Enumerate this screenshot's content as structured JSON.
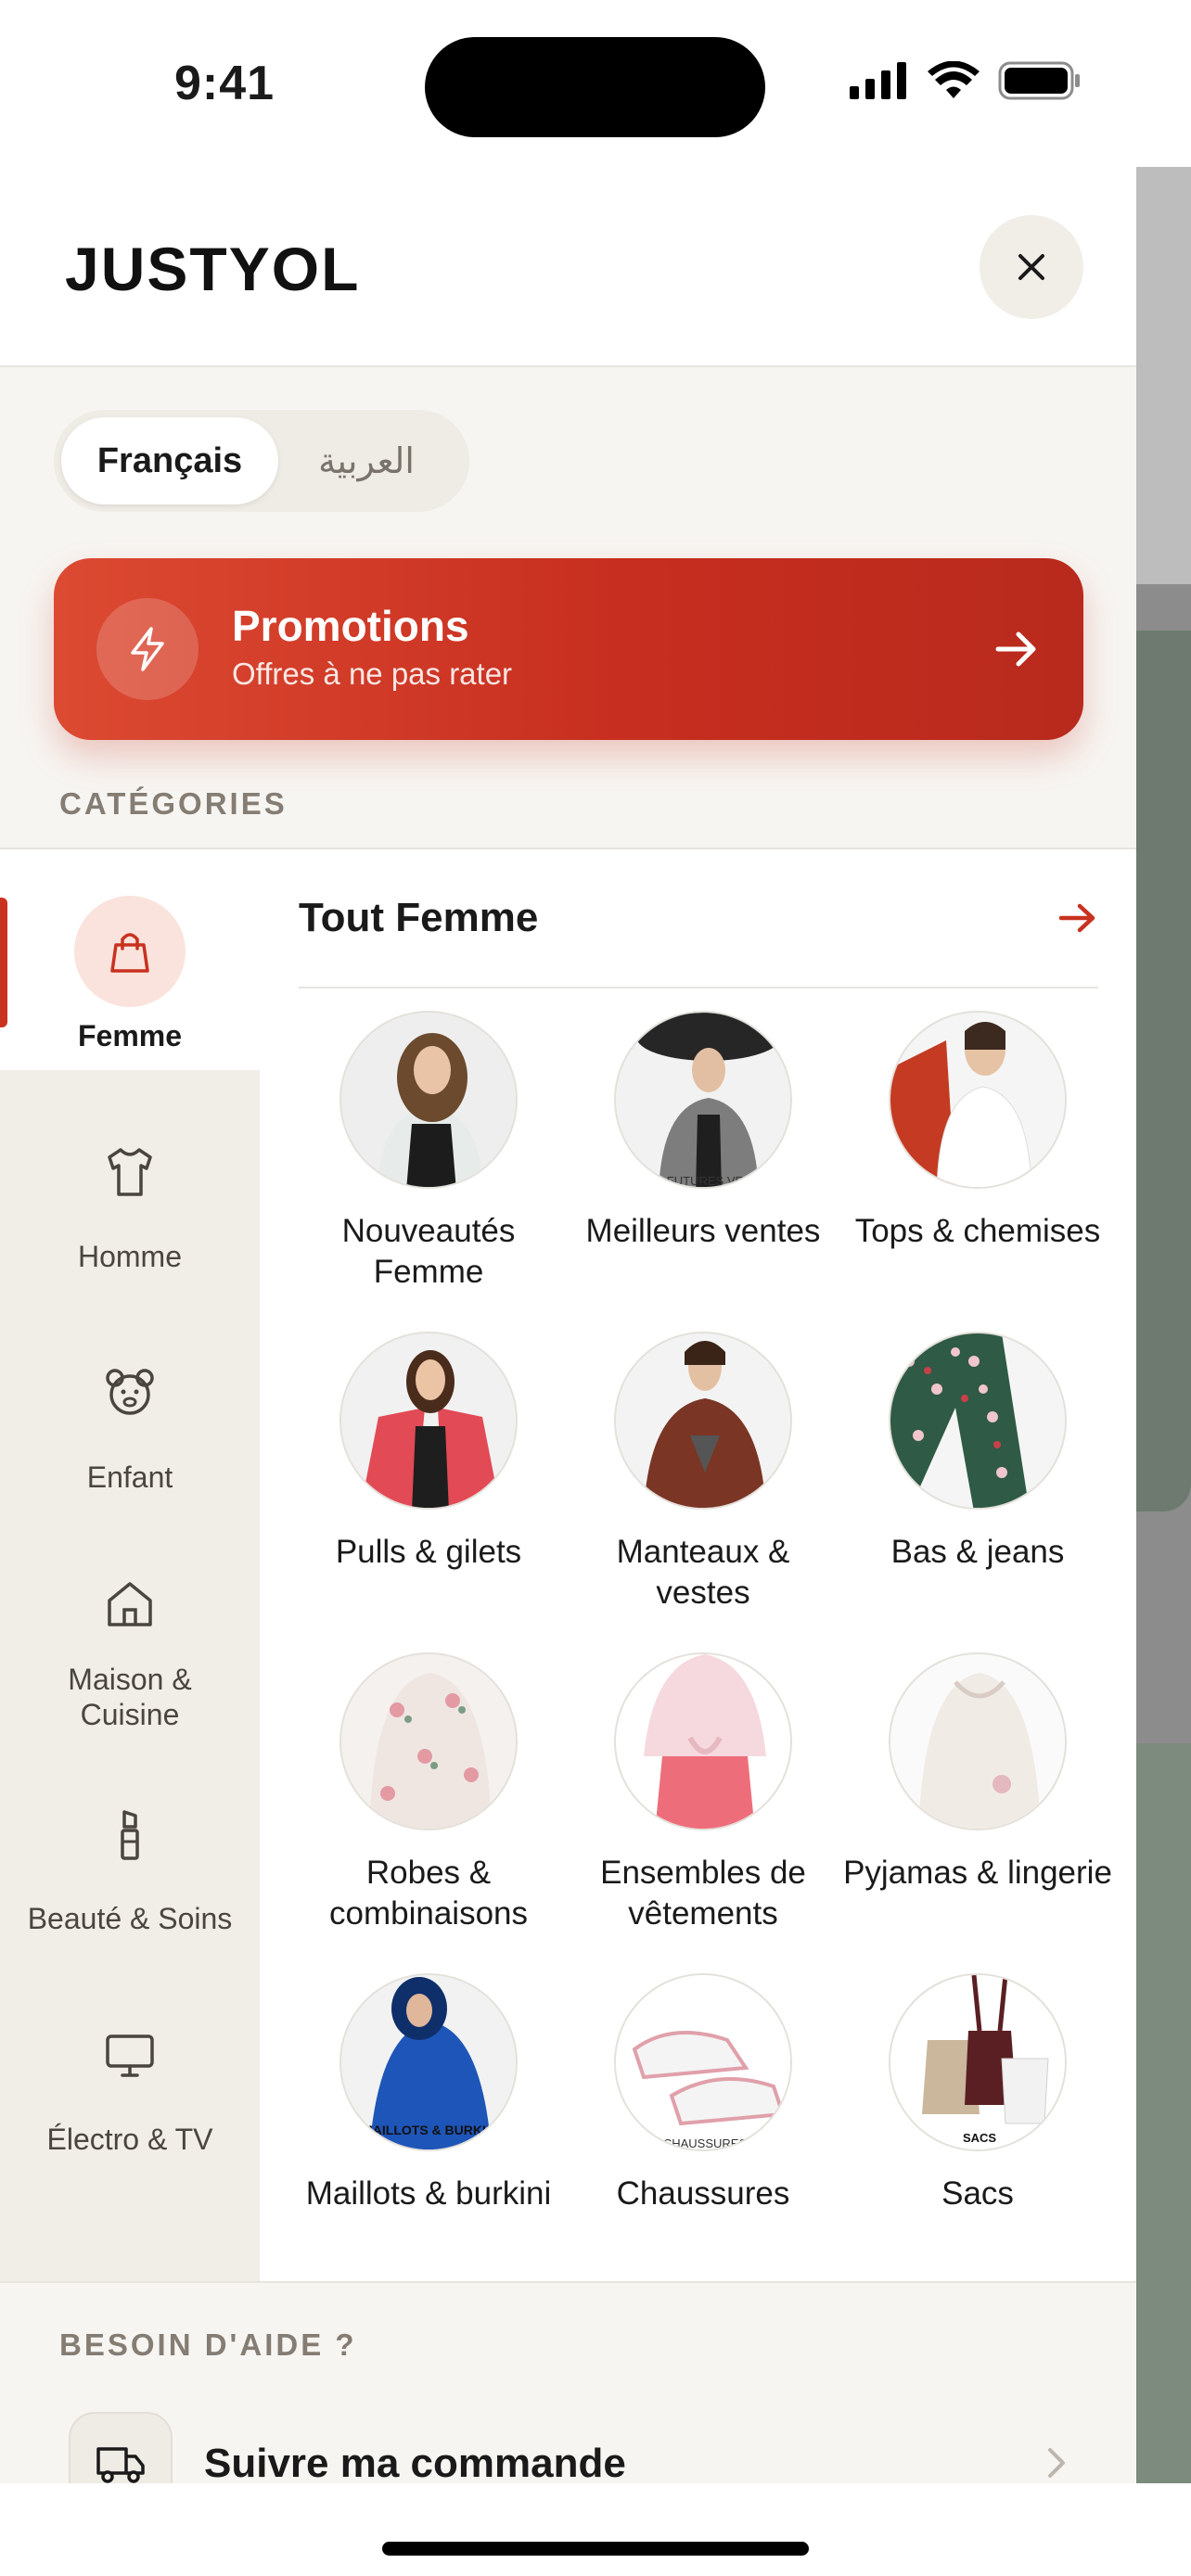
{
  "status_bar": {
    "time": "9:41"
  },
  "header": {
    "logo_text": "JUSTYOL"
  },
  "language": {
    "options": [
      {
        "label": "Français",
        "active": true
      },
      {
        "label": "العربية",
        "active": false
      }
    ]
  },
  "promo": {
    "title": "Promotions",
    "subtitle": "Offres à ne pas rater"
  },
  "categories": {
    "section_title": "CATÉGORIES",
    "items": [
      {
        "label": "Femme",
        "icon": "shopping-bag-icon",
        "active": true
      },
      {
        "label": "Homme",
        "icon": "tshirt-icon",
        "active": false
      },
      {
        "label": "Enfant",
        "icon": "teddy-bear-icon",
        "active": false
      },
      {
        "label": "Maison & Cuisine",
        "icon": "home-icon",
        "active": false
      },
      {
        "label": "Beauté & Soins",
        "icon": "lipstick-icon",
        "active": false
      },
      {
        "label": "Électro & TV",
        "icon": "monitor-icon",
        "active": false
      }
    ]
  },
  "subcategories": {
    "all_label": "Tout Femme",
    "items": [
      {
        "label": "Nouveautés Femme"
      },
      {
        "label": "Meilleurs ventes",
        "image_caption": "FUTURES VE"
      },
      {
        "label": "Tops & chemises"
      },
      {
        "label": "Pulls & gilets"
      },
      {
        "label": "Manteaux & vestes"
      },
      {
        "label": "Bas & jeans"
      },
      {
        "label": "Robes & combinaisons"
      },
      {
        "label": "Ensembles de vêtements"
      },
      {
        "label": "Pyjamas & lingerie"
      },
      {
        "label": "Maillots & burkini",
        "image_caption": "MAILLOTS & BURKINI"
      },
      {
        "label": "Chaussures",
        "image_caption": "CHAUSSURES"
      },
      {
        "label": "Sacs",
        "image_caption": "SACS"
      }
    ]
  },
  "help": {
    "section_title": "BESOIN D'AIDE ?",
    "track_label": "Suivre ma commande"
  },
  "colors": {
    "accent": "#c8321f",
    "promo_start": "#dc4a32",
    "promo_end": "#b82a1d",
    "drawer_bg": "#f7f5f2",
    "sidebar_bg": "#f1ede7"
  }
}
